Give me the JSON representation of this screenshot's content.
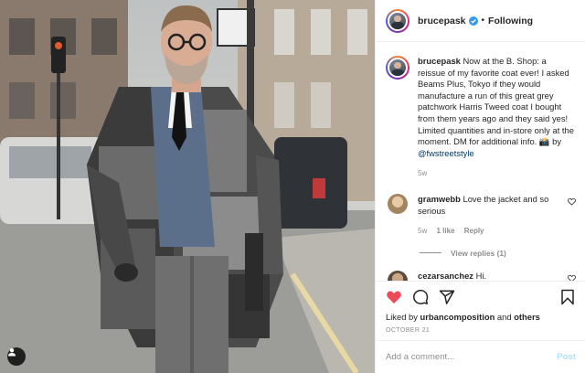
{
  "post": {
    "author": "brucepask",
    "follow_state": "Following",
    "separator": "•"
  },
  "caption": {
    "username": "brucepask",
    "text": "Now at the B. Shop: a reissue of my favorite coat ever! I asked Beams Plus, Tokyo if they would manufacture a run of this great grey patchwork Harris Tweed coat I bought from them years ago and they said yes! Limited quantities and in-store only at the moment. DM for additional info. 📸 by",
    "mention": "@fwstreetstyle",
    "age": "5w"
  },
  "comments": [
    {
      "username": "gramwebb",
      "text": "Love the jacket and so serious",
      "age": "5w",
      "likes": "1 like",
      "reply_label": "Reply",
      "view_replies": "View replies (1)"
    },
    {
      "username": "cezarsanchez",
      "text": "Hi."
    }
  ],
  "engagement": {
    "liked_by_prefix": "Liked by",
    "liked_by_user": "urbancomposition",
    "liked_by_and": "and",
    "liked_by_others": "others",
    "date": "OCTOBER 21"
  },
  "add_comment": {
    "placeholder": "Add a comment...",
    "post_label": "Post"
  },
  "icons": {
    "verified": "verified-badge-icon",
    "like": "heart-filled-icon",
    "comment": "comment-bubble-icon",
    "share": "paper-plane-icon",
    "save": "bookmark-icon",
    "user_tag": "user-tag-icon"
  },
  "colors": {
    "like_red": "#ed4956",
    "verified_blue": "#3897f0",
    "link_blue": "#00376b",
    "muted_gray": "#8e8e8e",
    "post_disabled": "#b2dffc"
  }
}
